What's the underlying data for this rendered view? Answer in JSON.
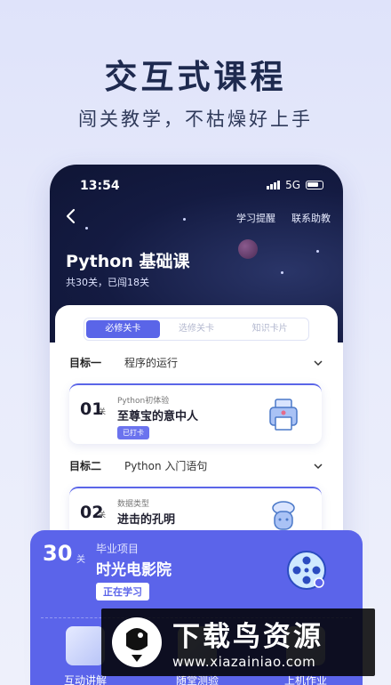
{
  "hero": {
    "title": "交互式课程",
    "subtitle": "闯关教学，不枯燥好上手"
  },
  "status_bar": {
    "time": "13:54",
    "network": "5G"
  },
  "header": {
    "nav_links": [
      "学习提醒",
      "联系助教"
    ],
    "course_title": "Python 基础课",
    "course_meta": "共30关，已闯18关"
  },
  "tabs": [
    {
      "label": "必修关卡",
      "active": true
    },
    {
      "label": "选修关卡",
      "active": false
    },
    {
      "label": "知识卡片",
      "active": false
    }
  ],
  "goals": [
    {
      "label": "目标一",
      "name": "程序的运行"
    },
    {
      "label": "目标二",
      "name": "Python 入门语句"
    }
  ],
  "lessons": [
    {
      "num": "01",
      "suffix": "关",
      "category": "Python初体验",
      "name": "至尊宝的意中人",
      "tag": "已打卡"
    },
    {
      "num": "02",
      "suffix": "关",
      "category": "数据类型",
      "name": "进击的孔明",
      "tag": ""
    }
  ],
  "final_project": {
    "num": "30",
    "suffix": "关",
    "category": "毕业项目",
    "name": "时光电影院",
    "status": "正在学习"
  },
  "features": [
    "互动讲解",
    "随堂测验",
    "上机作业"
  ],
  "watermark": {
    "title": "下载鸟资源",
    "url": "www.xiazainiao.com"
  },
  "colors": {
    "accent": "#5b64ea",
    "dark_bg": "#141b42",
    "hero_text": "#1e2a4f"
  }
}
